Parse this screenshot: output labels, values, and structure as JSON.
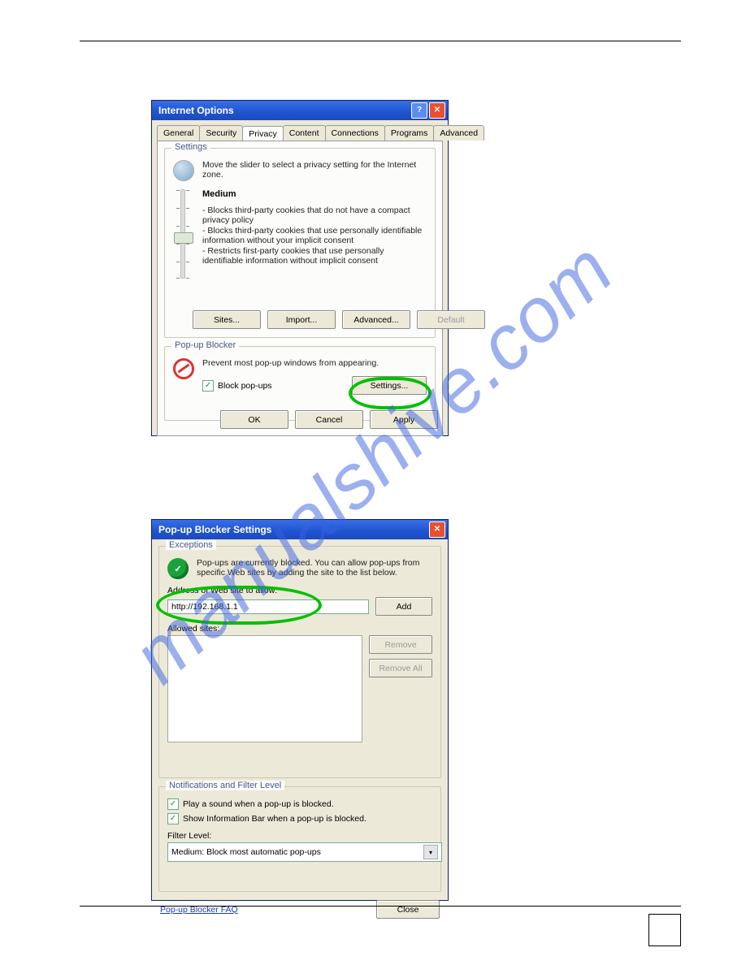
{
  "watermark": "manualshive.com",
  "dlg1": {
    "title": "Internet Options",
    "tabs": [
      "General",
      "Security",
      "Privacy",
      "Content",
      "Connections",
      "Programs",
      "Advanced"
    ],
    "active_tab": "Privacy",
    "settings": {
      "group_title": "Settings",
      "instruction": "Move the slider to select a privacy setting for the Internet zone.",
      "level": "Medium",
      "bullets": [
        "- Blocks third-party cookies that do not have a compact privacy policy",
        "- Blocks third-party cookies that use personally identifiable information without your implicit consent",
        "- Restricts first-party cookies that use personally identifiable information without implicit consent"
      ],
      "buttons": {
        "sites": "Sites...",
        "import": "Import...",
        "advanced": "Advanced...",
        "default": "Default"
      }
    },
    "popup": {
      "group_title": "Pop-up Blocker",
      "instruction": "Prevent most pop-up windows from appearing.",
      "checkbox": "Block pop-ups",
      "settings_btn": "Settings..."
    },
    "buttons": {
      "ok": "OK",
      "cancel": "Cancel",
      "apply": "Apply"
    }
  },
  "dlg2": {
    "title": "Pop-up Blocker Settings",
    "exceptions": {
      "group_title": "Exceptions",
      "instruction": "Pop-ups are currently blocked. You can allow pop-ups from specific Web sites by adding the site to the list below.",
      "address_label": "Address of Web site to allow:",
      "address_value": "http://192.168.1.1",
      "add_btn": "Add",
      "allowed_label": "Allowed sites:",
      "remove_btn": "Remove",
      "removeall_btn": "Remove All"
    },
    "notif": {
      "group_title": "Notifications and Filter Level",
      "cb1": "Play a sound when a pop-up is blocked.",
      "cb2": "Show Information Bar when a pop-up is blocked.",
      "filter_label": "Filter Level:",
      "filter_value": "Medium: Block most automatic pop-ups"
    },
    "faq_link": "Pop-up Blocker FAQ",
    "close_btn": "Close"
  }
}
